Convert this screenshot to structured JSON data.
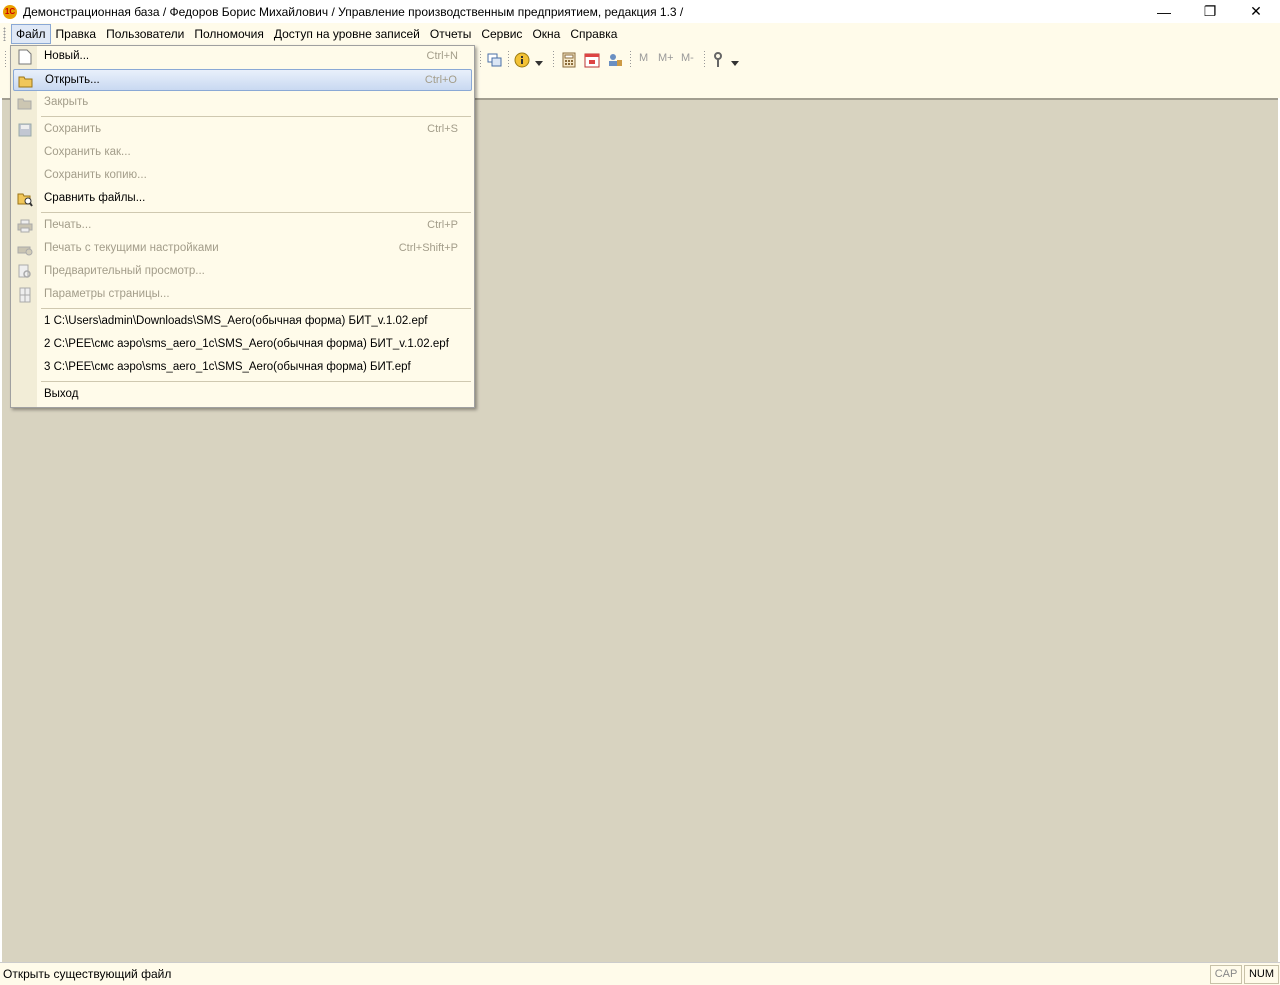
{
  "window": {
    "title": "Демонстрационная база / Федоров Борис Михайлович /  Управление производственным предприятием, редакция 1.3 /",
    "app_icon_text": "1С",
    "minimize_glyph": "—",
    "maximize_glyph": "❐",
    "close_glyph": "✕"
  },
  "menubar": {
    "items": [
      "Файл",
      "Правка",
      "Пользователи",
      "Полномочия",
      "Доступ на уровне записей",
      "Отчеты",
      "Сервис",
      "Окна",
      "Справка"
    ]
  },
  "toolbar": {
    "m_label": "M",
    "mplus_label": "M+",
    "mminus_label": "M-"
  },
  "file_menu": {
    "new": {
      "label": "Новый...",
      "shortcut": "Ctrl+N"
    },
    "open": {
      "label": "Открыть...",
      "shortcut": "Ctrl+O"
    },
    "close": {
      "label": "Закрыть"
    },
    "save": {
      "label": "Сохранить",
      "shortcut": "Ctrl+S"
    },
    "save_as": {
      "label": "Сохранить как..."
    },
    "save_copy": {
      "label": "Сохранить копию..."
    },
    "compare": {
      "label": "Сравнить файлы..."
    },
    "print": {
      "label": "Печать...",
      "shortcut": "Ctrl+P"
    },
    "print_current": {
      "label": "Печать с текущими настройками",
      "shortcut": "Ctrl+Shift+P"
    },
    "preview": {
      "label": "Предварительный просмотр..."
    },
    "page_setup": {
      "label": "Параметры страницы..."
    },
    "recent": [
      "1 C:\\Users\\admin\\Downloads\\SMS_Aero(обычная форма) БИТ_v.1.02.epf",
      "2 C:\\PEE\\смс аэро\\sms_aero_1c\\SMS_Aero(обычная форма) БИТ_v.1.02.epf",
      "3 C:\\PEE\\смс аэро\\sms_aero_1c\\SMS_Aero(обычная форма) БИТ.epf"
    ],
    "exit": {
      "label": "Выход"
    }
  },
  "statusbar": {
    "text": "Открыть существующий файл",
    "cap": "CAP",
    "num": "NUM"
  }
}
